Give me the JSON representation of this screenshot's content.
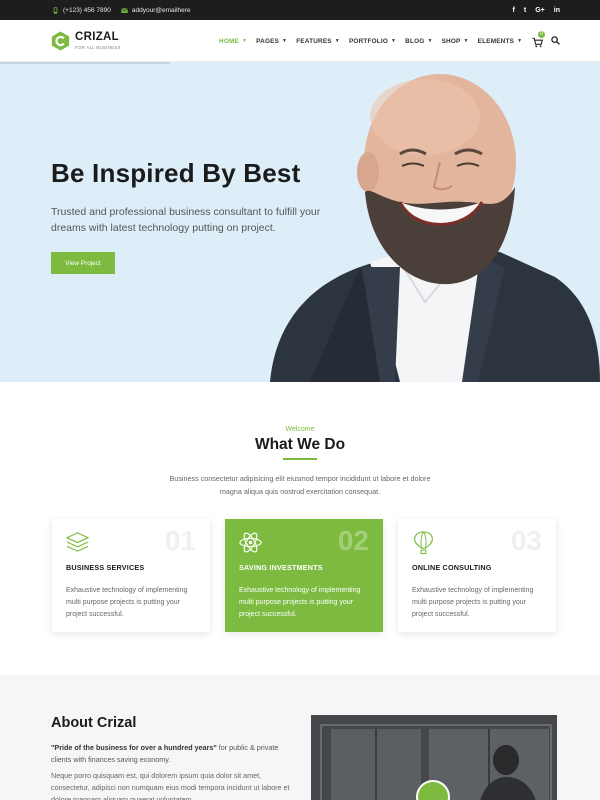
{
  "topbar": {
    "phone": "(+123) 456 7890",
    "email": "addyour@emailhere",
    "social": [
      "f",
      "t",
      "G+",
      "in"
    ]
  },
  "logo": {
    "name": "CRIZAL",
    "tagline": "FOR ALL BUSINESS"
  },
  "nav": {
    "items": [
      {
        "label": "HOME"
      },
      {
        "label": "PAGES"
      },
      {
        "label": "FEATURES"
      },
      {
        "label": "PORTFOLIO"
      },
      {
        "label": "BLOG"
      },
      {
        "label": "SHOP"
      },
      {
        "label": "ELEMENTS"
      }
    ],
    "cart_count": "0"
  },
  "hero": {
    "title": "Be Inspired By Best",
    "subtitle": "Trusted and professional business consultant to fulfill your dreams with latest technology putting on project.",
    "button": "View Project"
  },
  "services": {
    "eyebrow": "Welcome",
    "title": "What We Do",
    "description": "Business consectetur adipisicing elit eiusmod tempor incididunt ut labore et dolore magna aliqua quis nostrud exercitation consequat.",
    "cards": [
      {
        "number": "01",
        "icon": "stack-layers-icon",
        "title": "BUSINESS SERVICES",
        "text": "Exhaustive technology of implementing multi purpose projects is putting your project successful."
      },
      {
        "number": "02",
        "icon": "atom-icon",
        "title": "SAVING INVESTMENTS",
        "text": "Exhaustive technology of implementing multi purpose projects is putting your project successful."
      },
      {
        "number": "03",
        "icon": "hot-air-balloon-icon",
        "title": "ONLINE CONSULTING",
        "text": "Exhaustive technology of implementing multi purpose projects is putting your project successful."
      }
    ]
  },
  "about": {
    "title": "About Crizal",
    "quote_bold": "\"Pride of the business for over a hundred years\"",
    "quote_rest": " for public & private clients with finances saving economy.",
    "text": "Neque porro quisquam est, qui dolorem ipsum quia dolor sit amet, consectetur, adipisci non numquam eius modi tempora incidunt ut labore et dolore magnam aliquam quaerat voluptatem."
  },
  "colors": {
    "accent": "#7cbb3f",
    "topbar": "#1d1d1d",
    "hero_bg": "#ddeef8"
  }
}
